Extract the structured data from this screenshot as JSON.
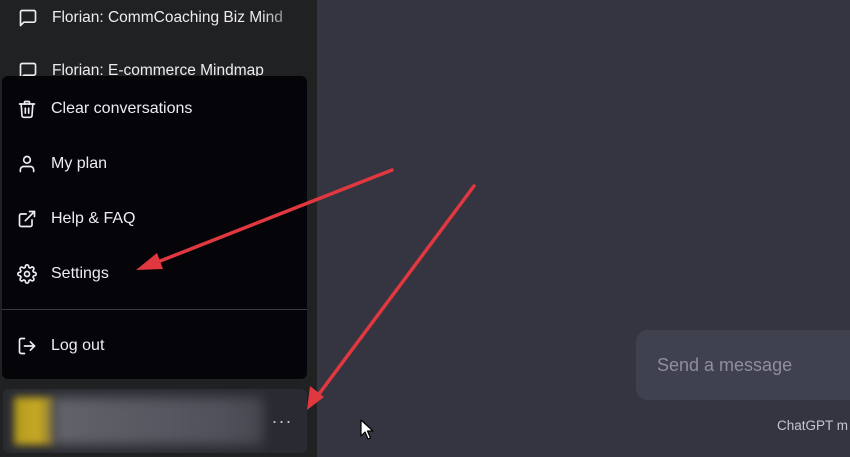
{
  "sidebar": {
    "conversations": [
      {
        "title": "Florian: CommCoaching Biz Mind",
        "icon": "chat-bubble-icon"
      },
      {
        "title": "Florian: E-commerce Mindmap",
        "icon": "chat-bubble-icon"
      }
    ]
  },
  "menu": {
    "items": [
      {
        "label": "Clear conversations",
        "icon": "trash-icon"
      },
      {
        "label": "My plan",
        "icon": "user-icon"
      },
      {
        "label": "Help & FAQ",
        "icon": "external-link-icon"
      },
      {
        "label": "Settings",
        "icon": "gear-icon"
      },
      {
        "label": "Log out",
        "icon": "logout-icon"
      }
    ]
  },
  "user": {
    "more_label": "···"
  },
  "composer": {
    "placeholder": "Send a message"
  },
  "footer": {
    "note": "ChatGPT m"
  },
  "colors": {
    "main_bg": "#343541",
    "sidebar_bg": "#202123",
    "menu_bg": "#050509",
    "annotation_arrow": "#e0383e"
  }
}
